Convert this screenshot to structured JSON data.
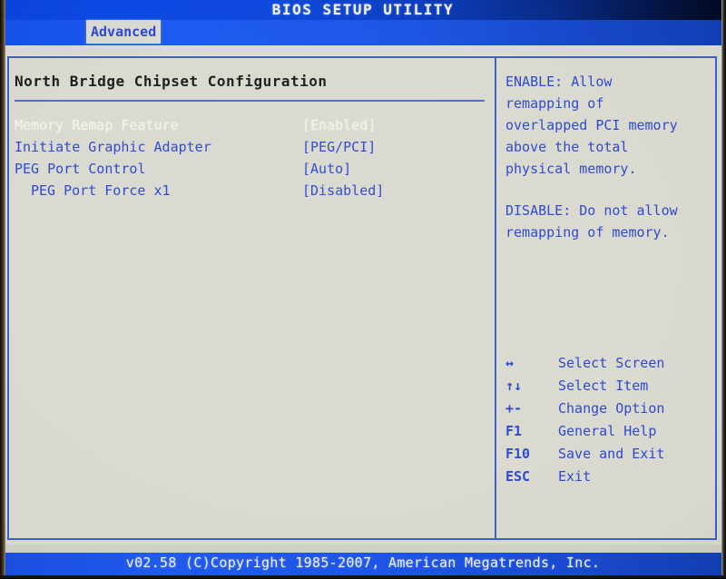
{
  "header": {
    "title": "BIOS SETUP UTILITY",
    "active_tab": "Advanced"
  },
  "main": {
    "section_title": "North Bridge Chipset Configuration",
    "items": [
      {
        "label": "Memory Remap Feature",
        "value": "[Enabled]",
        "selected": true,
        "indent": false
      },
      {
        "label": "Initiate Graphic Adapter",
        "value": "[PEG/PCI]",
        "selected": false,
        "indent": false
      },
      {
        "label": "PEG Port Control",
        "value": "[Auto]",
        "selected": false,
        "indent": false
      },
      {
        "label": "PEG Port Force x1",
        "value": "[Disabled]",
        "selected": false,
        "indent": true
      }
    ]
  },
  "help": {
    "lines_1": [
      "ENABLE: Allow",
      "remapping of",
      "overlapped PCI memory",
      "above the total",
      "physical memory."
    ],
    "lines_2": [
      "DISABLE: Do not allow",
      "remapping of memory."
    ]
  },
  "keys": [
    {
      "glyph": "↔",
      "desc": "Select Screen"
    },
    {
      "glyph": "↑↓",
      "desc": "Select Item"
    },
    {
      "glyph": "+-",
      "desc": "Change Option"
    },
    {
      "glyph": "F1",
      "desc": "General Help"
    },
    {
      "glyph": "F10",
      "desc": "Save and Exit"
    },
    {
      "glyph": "ESC",
      "desc": "Exit"
    }
  ],
  "footer": {
    "copyright": "v02.58 (C)Copyright 1985-2007, American Megatrends, Inc."
  },
  "colors": {
    "accent_blue": "#2b48cf",
    "frame_blue": "#3a5fd0",
    "titlebar_blue": "#0b47e4",
    "screen_bg": "#d9d9cf",
    "selected_text": "#f4f4ea",
    "section_title": "#1c1c1c"
  }
}
